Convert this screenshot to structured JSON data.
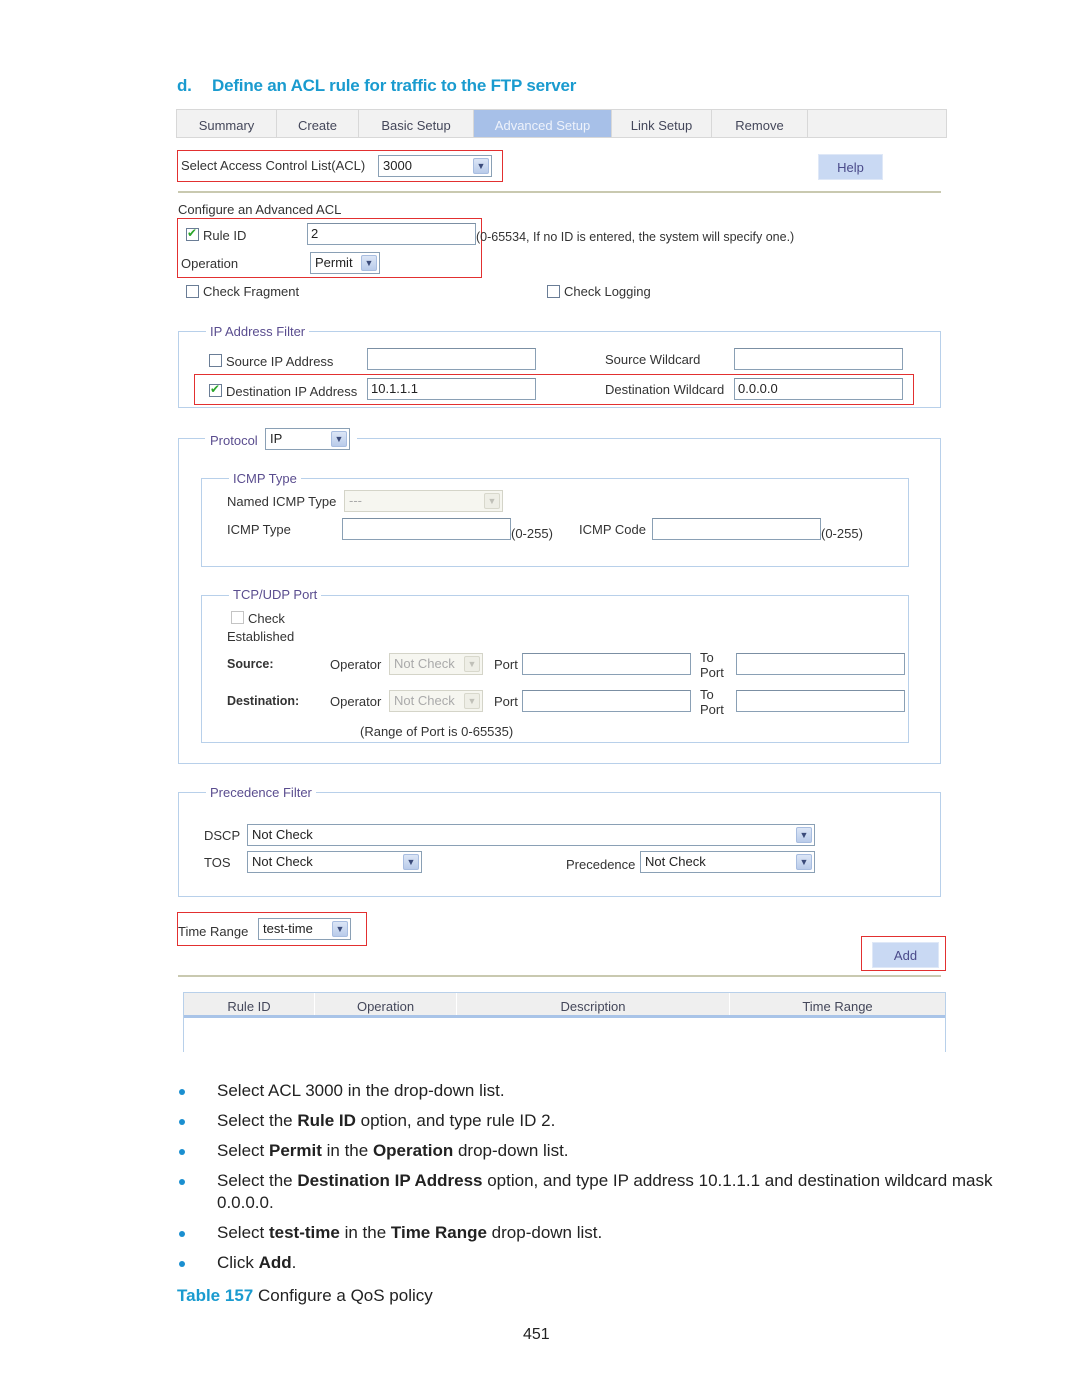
{
  "heading": {
    "number": "d.",
    "text": "Define an ACL rule for traffic to the FTP server"
  },
  "tabs": [
    {
      "label": "Summary",
      "active": false
    },
    {
      "label": "Create",
      "active": false
    },
    {
      "label": "Basic Setup",
      "active": false
    },
    {
      "label": "Advanced Setup",
      "active": true
    },
    {
      "label": "Link Setup",
      "active": false
    },
    {
      "label": "Remove",
      "active": false
    }
  ],
  "acl_select": {
    "label": "Select Access Control List(ACL)",
    "value": "3000"
  },
  "help_button": "Help",
  "config": {
    "title": "Configure an Advanced ACL",
    "rule_id": {
      "label": "Rule ID",
      "checked": true,
      "value": "2",
      "hint": "(0-65534, If no ID is entered, the system will specify one.)"
    },
    "operation": {
      "label": "Operation",
      "value": "Permit"
    },
    "check_fragment": {
      "label": "Check Fragment",
      "checked": false
    },
    "check_logging": {
      "label": "Check Logging",
      "checked": false
    }
  },
  "ip_filter": {
    "legend": "IP Address Filter",
    "source_ip": {
      "label": "Source IP Address",
      "checked": false,
      "value": ""
    },
    "source_wildcard": {
      "label": "Source Wildcard",
      "value": ""
    },
    "dest_ip": {
      "label": "Destination IP Address",
      "checked": true,
      "value": "10.1.1.1"
    },
    "dest_wildcard": {
      "label": "Destination Wildcard",
      "value": "0.0.0.0"
    }
  },
  "protocol": {
    "label": "Protocol",
    "value": "IP",
    "icmp": {
      "legend": "ICMP Type",
      "named_label": "Named ICMP Type",
      "named_value": "---",
      "type_label": "ICMP Type",
      "type_value": "",
      "type_range": "(0-255)",
      "code_label": "ICMP Code",
      "code_value": "",
      "code_range": "(0-255)"
    },
    "tcpudp": {
      "legend": "TCP/UDP Port",
      "check_established": {
        "label_line1": "Check",
        "label_line2": "Established",
        "checked": false
      },
      "source": {
        "label": "Source:",
        "operator_label": "Operator",
        "operator_value": "Not Check",
        "port_label": "Port",
        "port_value": "",
        "to_port_label_1": "To",
        "to_port_label_2": "Port",
        "to_port_value": ""
      },
      "destination": {
        "label": "Destination:",
        "operator_label": "Operator",
        "operator_value": "Not Check",
        "port_label": "Port",
        "port_value": "",
        "to_port_label_1": "To",
        "to_port_label_2": "Port",
        "to_port_value": ""
      },
      "range_note": "(Range of Port is 0-65535)"
    }
  },
  "precedence_filter": {
    "legend": "Precedence Filter",
    "dscp": {
      "label": "DSCP",
      "value": "Not Check"
    },
    "tos": {
      "label": "TOS",
      "value": "Not Check"
    },
    "precedence": {
      "label": "Precedence",
      "value": "Not Check"
    }
  },
  "time_range": {
    "label": "Time Range",
    "value": "test-time"
  },
  "add_button": "Add",
  "result_table": {
    "columns": [
      "Rule ID",
      "Operation",
      "Description",
      "Time Range"
    ],
    "rows": []
  },
  "steps": [
    {
      "parts": [
        {
          "t": "Select ACL 3000 in the drop-down list."
        }
      ]
    },
    {
      "parts": [
        {
          "t": "Select the "
        },
        {
          "t": "Rule ID",
          "b": true
        },
        {
          "t": " option, and type rule ID 2."
        }
      ]
    },
    {
      "parts": [
        {
          "t": "Select "
        },
        {
          "t": "Permit",
          "b": true
        },
        {
          "t": " in the "
        },
        {
          "t": "Operation",
          "b": true
        },
        {
          "t": " drop-down list."
        }
      ]
    },
    {
      "parts": [
        {
          "t": "Select the "
        },
        {
          "t": "Destination IP Address",
          "b": true
        },
        {
          "t": " option, and type IP address 10.1.1.1 and destination wildcard mask 0.0.0.0."
        }
      ]
    },
    {
      "parts": [
        {
          "t": "Select "
        },
        {
          "t": "test-time",
          "b": true
        },
        {
          "t": " in the "
        },
        {
          "t": "Time Range",
          "b": true
        },
        {
          "t": " drop-down list."
        }
      ]
    },
    {
      "parts": [
        {
          "t": "Click "
        },
        {
          "t": "Add",
          "b": true
        },
        {
          "t": "."
        }
      ]
    }
  ],
  "caption": {
    "label": "Table 157",
    "text": " Configure a QoS policy"
  },
  "page_number": "451"
}
